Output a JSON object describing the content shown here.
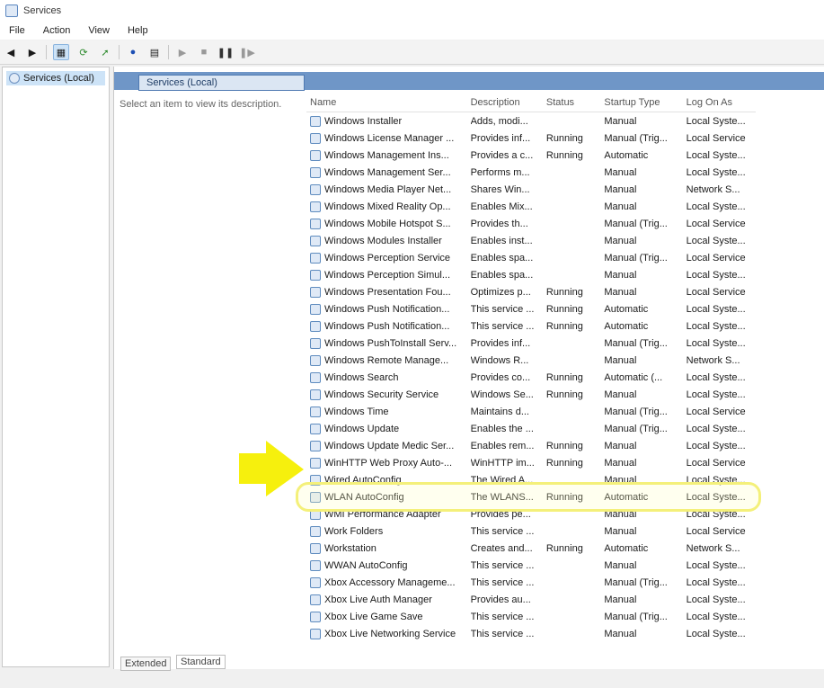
{
  "window": {
    "title": "Services"
  },
  "menus": [
    "File",
    "Action",
    "View",
    "Help"
  ],
  "toolbar_icons": [
    "back-icon",
    "forward-icon",
    "console-tree-icon",
    "refresh-icon",
    "export-icon",
    "help-icon",
    "properties-icon",
    "start-icon",
    "stop-icon",
    "pause-icon",
    "restart-icon"
  ],
  "left_tree": {
    "selected_label": "Services (Local)"
  },
  "main": {
    "header_title": "Services (Local)",
    "description_hint": "Select an item to view its description.",
    "columns": [
      "Name",
      "Description",
      "Status",
      "Startup Type",
      "Log On As"
    ],
    "rows": [
      {
        "name": "Windows Installer",
        "desc": "Adds, modi...",
        "status": "",
        "startup": "Manual",
        "logon": "Local Syste..."
      },
      {
        "name": "Windows License Manager ...",
        "desc": "Provides inf...",
        "status": "Running",
        "startup": "Manual (Trig...",
        "logon": "Local Service"
      },
      {
        "name": "Windows Management Ins...",
        "desc": "Provides a c...",
        "status": "Running",
        "startup": "Automatic",
        "logon": "Local Syste..."
      },
      {
        "name": "Windows Management Ser...",
        "desc": "Performs m...",
        "status": "",
        "startup": "Manual",
        "logon": "Local Syste..."
      },
      {
        "name": "Windows Media Player Net...",
        "desc": "Shares Win...",
        "status": "",
        "startup": "Manual",
        "logon": "Network S..."
      },
      {
        "name": "Windows Mixed Reality Op...",
        "desc": "Enables Mix...",
        "status": "",
        "startup": "Manual",
        "logon": "Local Syste..."
      },
      {
        "name": "Windows Mobile Hotspot S...",
        "desc": "Provides th...",
        "status": "",
        "startup": "Manual (Trig...",
        "logon": "Local Service"
      },
      {
        "name": "Windows Modules Installer",
        "desc": "Enables inst...",
        "status": "",
        "startup": "Manual",
        "logon": "Local Syste..."
      },
      {
        "name": "Windows Perception Service",
        "desc": "Enables spa...",
        "status": "",
        "startup": "Manual (Trig...",
        "logon": "Local Service"
      },
      {
        "name": "Windows Perception Simul...",
        "desc": "Enables spa...",
        "status": "",
        "startup": "Manual",
        "logon": "Local Syste..."
      },
      {
        "name": "Windows Presentation Fou...",
        "desc": "Optimizes p...",
        "status": "Running",
        "startup": "Manual",
        "logon": "Local Service"
      },
      {
        "name": "Windows Push Notification...",
        "desc": "This service ...",
        "status": "Running",
        "startup": "Automatic",
        "logon": "Local Syste..."
      },
      {
        "name": "Windows Push Notification...",
        "desc": "This service ...",
        "status": "Running",
        "startup": "Automatic",
        "logon": "Local Syste..."
      },
      {
        "name": "Windows PushToInstall Serv...",
        "desc": "Provides inf...",
        "status": "",
        "startup": "Manual (Trig...",
        "logon": "Local Syste..."
      },
      {
        "name": "Windows Remote Manage...",
        "desc": "Windows R...",
        "status": "",
        "startup": "Manual",
        "logon": "Network S..."
      },
      {
        "name": "Windows Search",
        "desc": "Provides co...",
        "status": "Running",
        "startup": "Automatic (...",
        "logon": "Local Syste..."
      },
      {
        "name": "Windows Security Service",
        "desc": "Windows Se...",
        "status": "Running",
        "startup": "Manual",
        "logon": "Local Syste..."
      },
      {
        "name": "Windows Time",
        "desc": "Maintains d...",
        "status": "",
        "startup": "Manual (Trig...",
        "logon": "Local Service"
      },
      {
        "name": "Windows Update",
        "desc": "Enables the ...",
        "status": "",
        "startup": "Manual (Trig...",
        "logon": "Local Syste..."
      },
      {
        "name": "Windows Update Medic Ser...",
        "desc": "Enables rem...",
        "status": "Running",
        "startup": "Manual",
        "logon": "Local Syste..."
      },
      {
        "name": "WinHTTP Web Proxy Auto-...",
        "desc": "WinHTTP im...",
        "status": "Running",
        "startup": "Manual",
        "logon": "Local Service"
      },
      {
        "name": "Wired AutoConfig",
        "desc": "The Wired A...",
        "status": "",
        "startup": "Manual",
        "logon": "Local Syste..."
      },
      {
        "name": "WLAN AutoConfig",
        "desc": "The WLANS...",
        "status": "Running",
        "startup": "Automatic",
        "logon": "Local Syste..."
      },
      {
        "name": "WMI Performance Adapter",
        "desc": "Provides pe...",
        "status": "",
        "startup": "Manual",
        "logon": "Local Syste..."
      },
      {
        "name": "Work Folders",
        "desc": "This service ...",
        "status": "",
        "startup": "Manual",
        "logon": "Local Service"
      },
      {
        "name": "Workstation",
        "desc": "Creates and...",
        "status": "Running",
        "startup": "Automatic",
        "logon": "Network S..."
      },
      {
        "name": "WWAN AutoConfig",
        "desc": "This service ...",
        "status": "",
        "startup": "Manual",
        "logon": "Local Syste..."
      },
      {
        "name": "Xbox Accessory Manageme...",
        "desc": "This service ...",
        "status": "",
        "startup": "Manual (Trig...",
        "logon": "Local Syste..."
      },
      {
        "name": "Xbox Live Auth Manager",
        "desc": "Provides au...",
        "status": "",
        "startup": "Manual",
        "logon": "Local Syste..."
      },
      {
        "name": "Xbox Live Game Save",
        "desc": "This service ...",
        "status": "",
        "startup": "Manual (Trig...",
        "logon": "Local Syste..."
      },
      {
        "name": "Xbox Live Networking Service",
        "desc": "This service ...",
        "status": "",
        "startup": "Manual",
        "logon": "Local Syste..."
      }
    ],
    "highlighted_row": "WLAN AutoConfig"
  },
  "bottom_tabs": [
    "Extended",
    "Standard"
  ],
  "annotation": {
    "arrow_color": "#f5ef00",
    "highlight_color": "#f4f07a"
  }
}
